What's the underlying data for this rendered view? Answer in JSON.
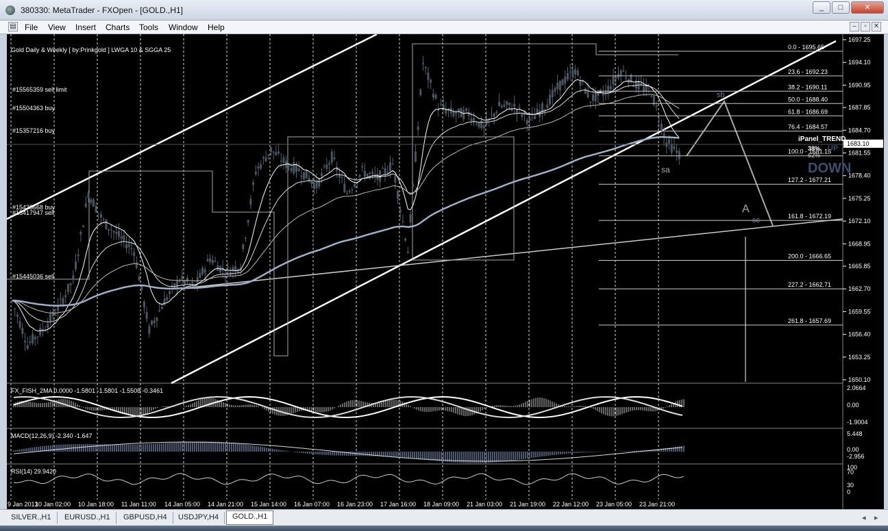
{
  "window": {
    "title": "380330: MetaTrader - FXOpen - [GOLD.,H1]",
    "controls": [
      "_",
      "□",
      "✕"
    ],
    "child_controls": [
      "–",
      "▫",
      "✕"
    ]
  },
  "menu": [
    "File",
    "View",
    "Insert",
    "Charts",
    "Tools",
    "Window",
    "Help"
  ],
  "chart_header": "Gold Daily & Weekly [ by:Prinkgold ]  LWGA 10  &  SGGA 25",
  "order_labels": {
    "sell_limit": "#15565359 sell limit",
    "buy1": "#15504363 buy",
    "buy2": "#15357216 buy",
    "buy3": "#15438668 buy",
    "sell1": "#15417947 sell",
    "sell2": "#15445036 sell"
  },
  "ipanel": {
    "title": "iPanel_TREND",
    "pct": "38%",
    "up": "UP",
    "down": "DOWN",
    "pct2": "62%"
  },
  "annotations": {
    "sa": "sa",
    "sb": "sb",
    "sc": "sc",
    "A": "A"
  },
  "colors": {
    "background": "#000000",
    "grid": "#ffffff",
    "candles": "#4b5560",
    "ma_blue": "#9fb0c8",
    "text": "#ffffff"
  },
  "chart_data": {
    "type": "line",
    "symbol": "GOLD.,H1",
    "price_axis": {
      "ticks": [
        "1697.25",
        "1694.10",
        "1690.95",
        "1687.85",
        "1684.70",
        "1681.55",
        "1678.40",
        "1675.25",
        "1672.10",
        "1668.95",
        "1665.85",
        "1662.70",
        "1659.55",
        "1656.40",
        "1653.25",
        "1650.10"
      ],
      "current_price": "1683.10",
      "ylim": [
        1650.1,
        1697.25
      ]
    },
    "time_axis": [
      "9 Jan 2013",
      "10 Jan 02:00",
      "10 Jan 18:00",
      "11 Jan 11:00",
      "14 Jan 05:00",
      "14 Jan 21:00",
      "15 Jan 14:00",
      "16 Jan 07:00",
      "16 Jan 23:00",
      "17 Jan 16:00",
      "18 Jan 09:00",
      "21 Jan 03:00",
      "21 Jan 19:00",
      "22 Jan 12:00",
      "23 Jan 05:00",
      "23 Jan 21:00"
    ],
    "fibonacci": [
      {
        "level": "0.0",
        "price": 1695.65,
        "label": "0.0 - 1695.65"
      },
      {
        "level": "23.6",
        "price": 1692.23,
        "label": "23.6 - 1692.23"
      },
      {
        "level": "38.2",
        "price": 1690.11,
        "label": "38.2 - 1690.11"
      },
      {
        "level": "50.0",
        "price": 1688.4,
        "label": "50.0 - 1688.40"
      },
      {
        "level": "61.8",
        "price": 1686.69,
        "label": "61.8 - 1686.69"
      },
      {
        "level": "76.4",
        "price": 1684.57,
        "label": "76.4 - 1684.57"
      },
      {
        "level": "100.0",
        "price": 1681.15,
        "label": "100.0 - 1681.15"
      },
      {
        "level": "127.2",
        "price": 1677.21,
        "label": "127.2 - 1677.21"
      },
      {
        "level": "161.8",
        "price": 1672.19,
        "label": "161.8 - 1672.19"
      },
      {
        "level": "200.0",
        "price": 1666.65,
        "label": "200.0 - 1666.65"
      },
      {
        "level": "227.2",
        "price": 1662.71,
        "label": "227.2 - 1662.71"
      },
      {
        "level": "261.8",
        "price": 1657.69,
        "label": "261.8 - 1657.69"
      }
    ],
    "close_series_approx": [
      1661,
      1655,
      1657,
      1660,
      1664,
      1676,
      1672,
      1670,
      1668,
      1657,
      1661,
      1664,
      1663,
      1667,
      1665,
      1666,
      1679,
      1682,
      1680,
      1679,
      1677,
      1681,
      1676,
      1679,
      1678,
      1680,
      1668,
      1694,
      1688,
      1687,
      1687,
      1685,
      1688,
      1688,
      1686,
      1688,
      1691,
      1693,
      1689,
      1690,
      1693,
      1691,
      1690,
      1683,
      1681
    ],
    "indicators": [
      {
        "name": "FX_FISH_2MA",
        "label": "FX_FISH_2MA 0.0000 -1.5801 -1.5801 -1.5508 -0.3461",
        "axis": [
          "2.0664",
          "0.00",
          "-1.9004"
        ]
      },
      {
        "name": "MACD(12,26,9)",
        "label": "MACD(12,26,9) -2.340 -1.647",
        "axis": [
          "5.448",
          "0.00",
          "-2.956"
        ]
      },
      {
        "name": "RSI(14)",
        "label": "RSI(14) 29.9420",
        "axis": [
          "100",
          "70",
          "30",
          "0"
        ]
      }
    ]
  },
  "tabs": [
    {
      "label": "SILVER.,H1",
      "active": false
    },
    {
      "label": "EURUSD.,H1",
      "active": false
    },
    {
      "label": "GBPUSD,H4",
      "active": false
    },
    {
      "label": "USDJPY,H4",
      "active": false
    },
    {
      "label": "GOLD.,H1",
      "active": true
    }
  ]
}
